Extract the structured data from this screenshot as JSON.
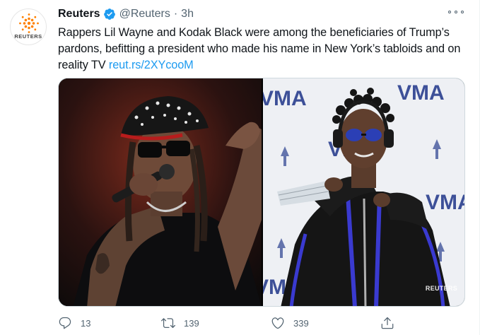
{
  "tweet": {
    "author_name": "Reuters",
    "handle": "@Reuters",
    "separator": "·",
    "time": "3h",
    "avatar_text": "REUTERS",
    "text": "Rappers Lil Wayne and Kodak Black were among the beneficiaries of Trump’s pardons, befitting a president who made his name in New York’s tabloids and on reality TV ",
    "link": "reut.rs/2XYcooM",
    "media_watermark": "REUTERS",
    "icons": {
      "verified": "verified-badge-icon",
      "more": "more-options-icon",
      "reply": "reply-icon",
      "retweet": "retweet-icon",
      "like": "like-icon",
      "share": "share-icon"
    }
  },
  "actions": {
    "reply_count": "13",
    "retweet_count": "139",
    "like_count": "339"
  },
  "colors": {
    "link": "#1d9bf0",
    "secondary_text": "#536471",
    "verified": "#1d9bf0",
    "brand_orange": "#ff8000"
  }
}
